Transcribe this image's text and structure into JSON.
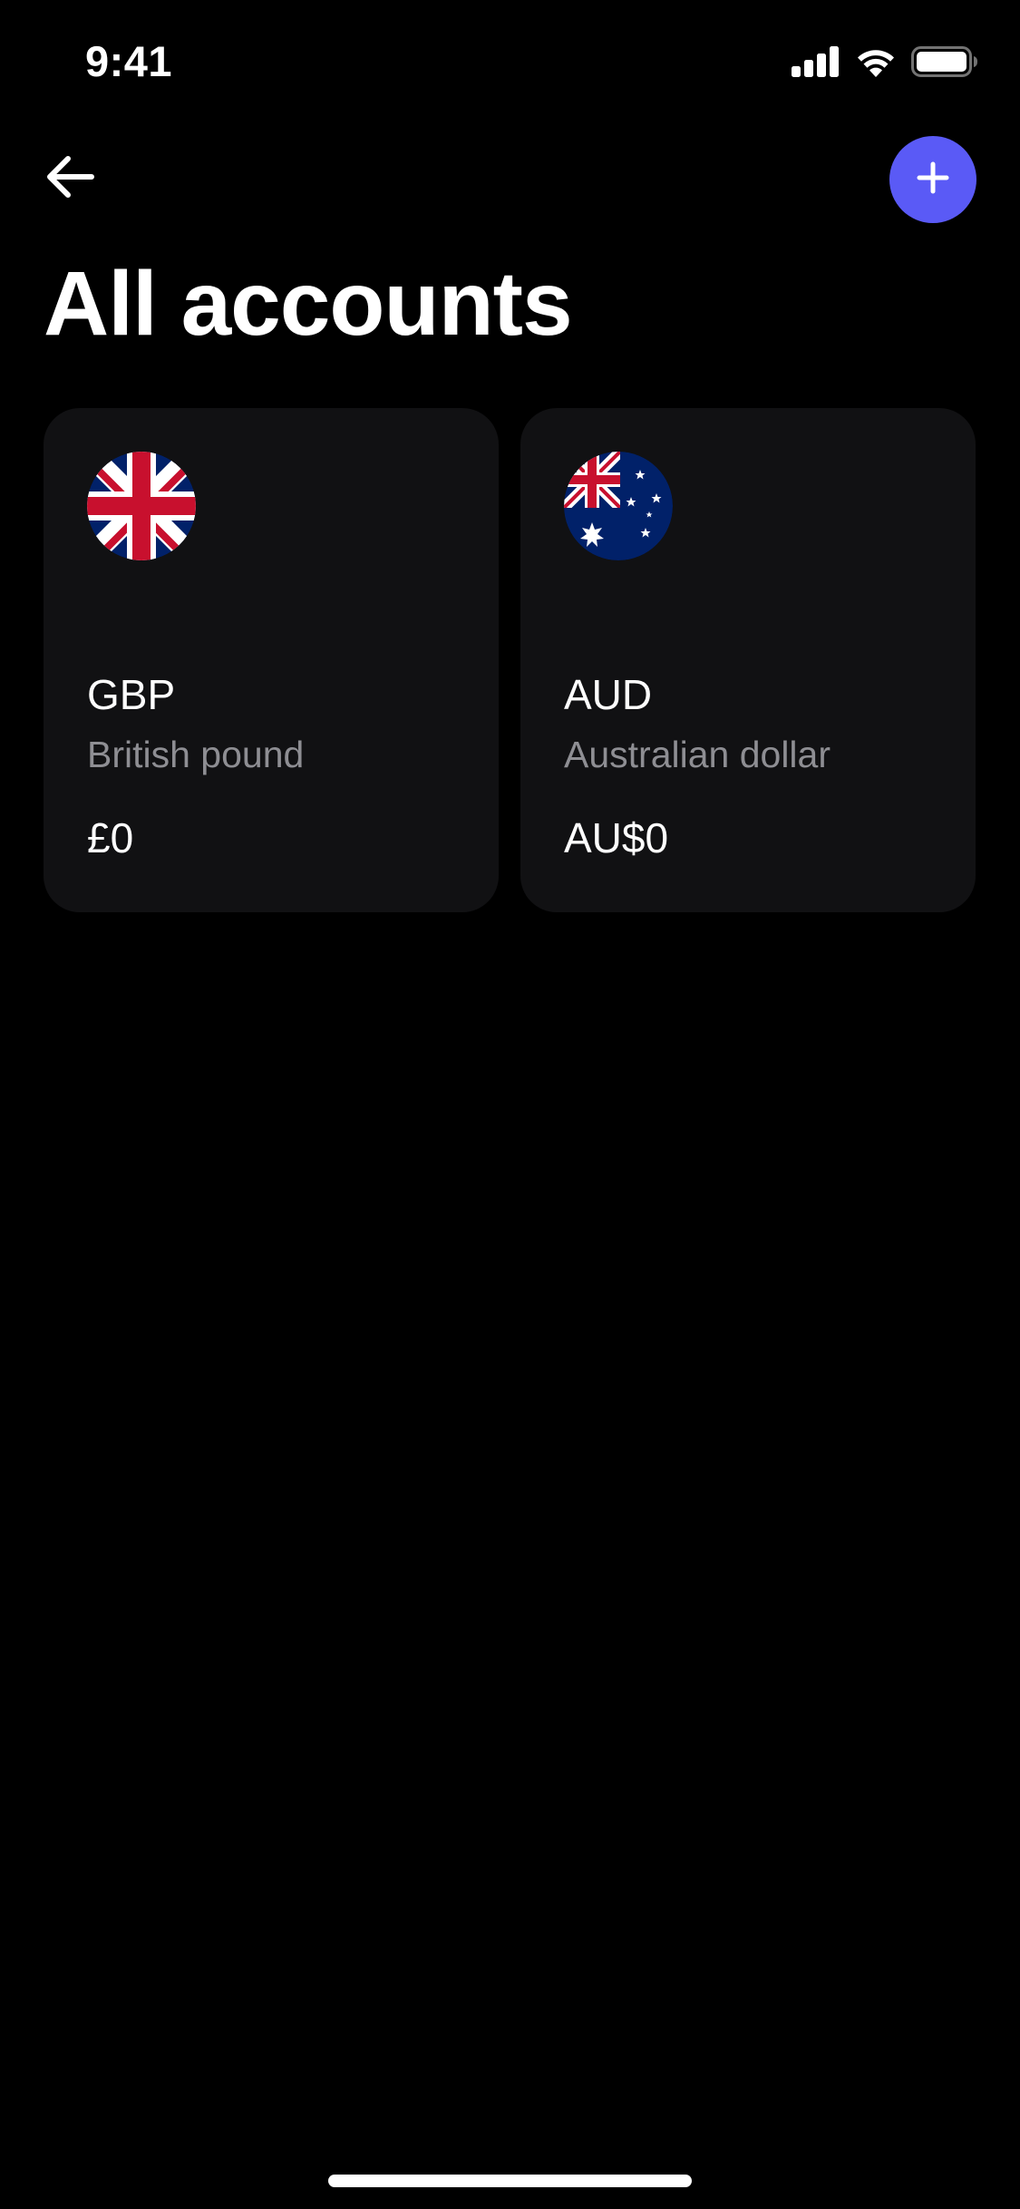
{
  "status_bar": {
    "time": "9:41",
    "icons": [
      "cellular-signal-icon",
      "wifi-icon",
      "battery-icon"
    ]
  },
  "header": {
    "back_icon": "arrow-left-icon",
    "add_icon": "plus-icon",
    "title": "All accounts"
  },
  "accounts": [
    {
      "code": "GBP",
      "name": "British pound",
      "balance": "£0",
      "flag": "uk-flag-icon"
    },
    {
      "code": "AUD",
      "name": "Australian dollar",
      "balance": "AU$0",
      "flag": "australia-flag-icon"
    }
  ],
  "colors": {
    "background": "#000000",
    "card": "#111113",
    "accent": "#5a5af6",
    "secondary_text": "#8e8e93"
  }
}
